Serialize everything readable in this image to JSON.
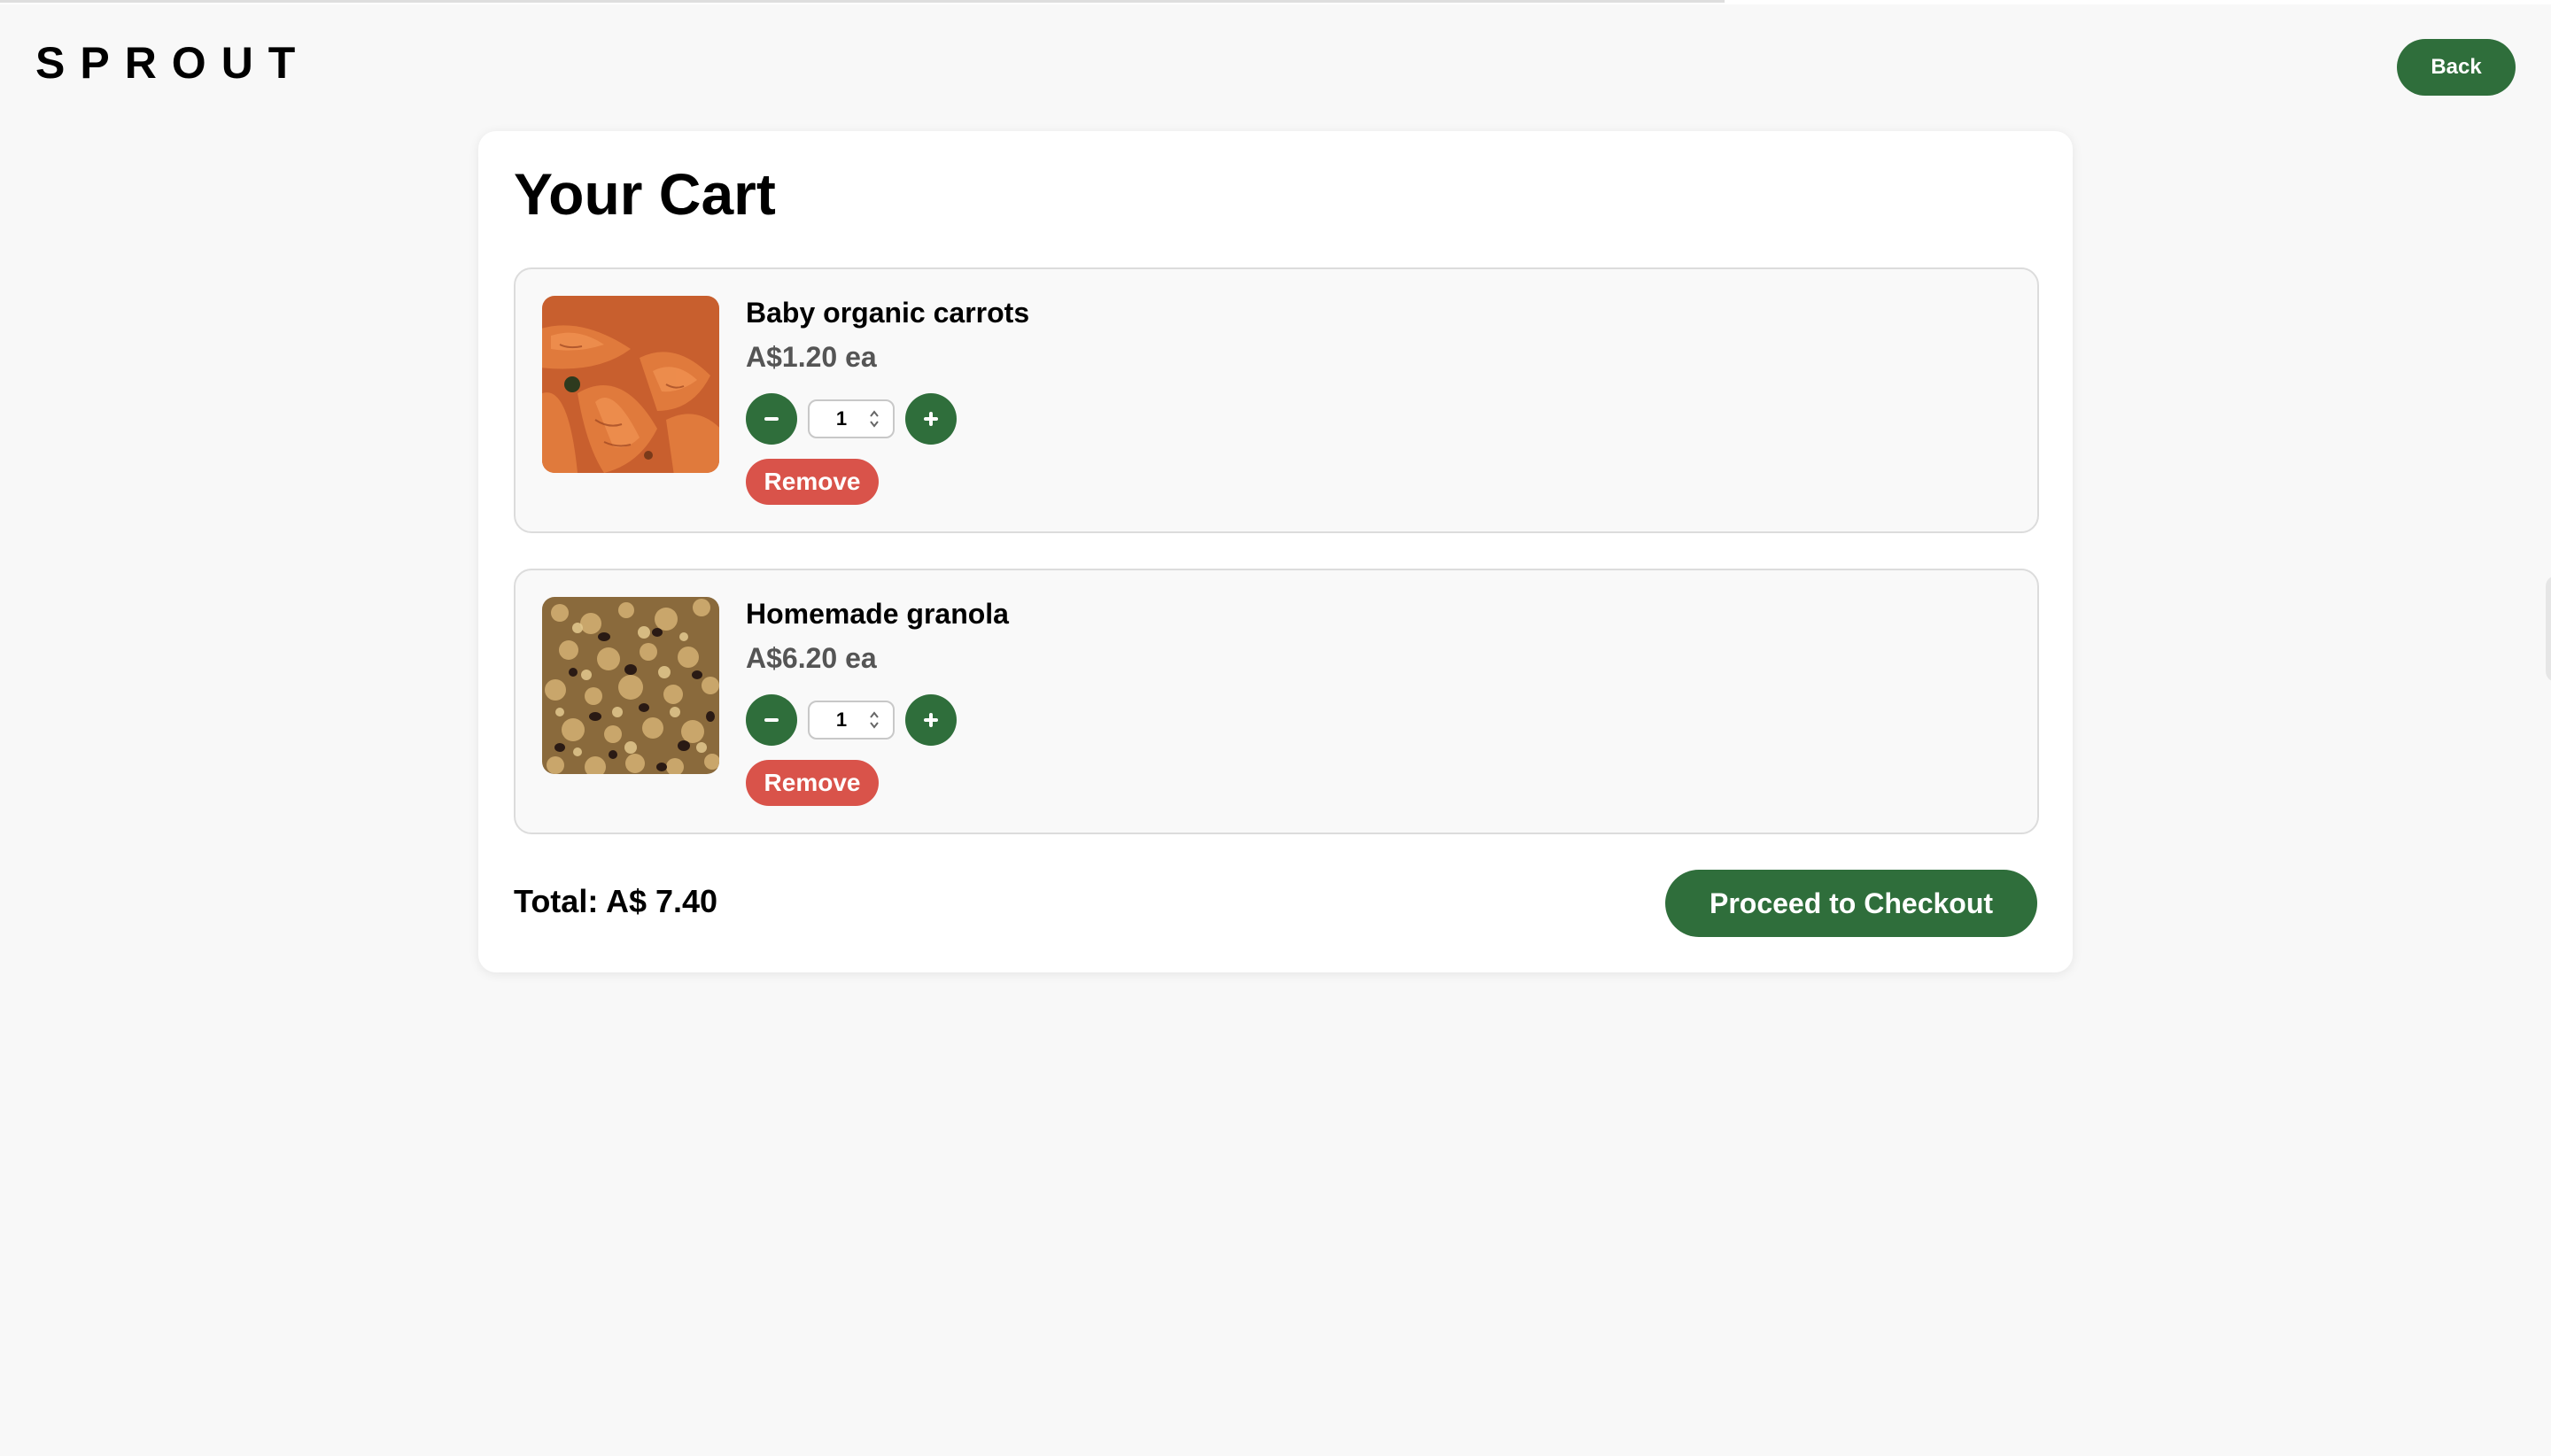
{
  "header": {
    "logo": "SPROUT",
    "back_label": "Back"
  },
  "cart": {
    "title": "Your Cart",
    "items": [
      {
        "name": "Baby organic carrots",
        "price": "A$1.20 ea",
        "quantity": "1",
        "decrement_icon": "minus-icon",
        "increment_icon": "plus-icon",
        "remove_label": "Remove",
        "image": "carrots-photo"
      },
      {
        "name": "Homemade granola",
        "price": "A$6.20 ea",
        "quantity": "1",
        "decrement_icon": "minus-icon",
        "increment_icon": "plus-icon",
        "remove_label": "Remove",
        "image": "granola-photo"
      }
    ],
    "total": "Total: A$ 7.40",
    "checkout_label": "Proceed to Checkout"
  },
  "colors": {
    "background": "#f8f8f8",
    "brand_green": "#2f6e3b",
    "remove_red": "#d9534a",
    "price_gray": "#555555",
    "card": "#ffffff",
    "item_card": "#f9f9f9"
  }
}
